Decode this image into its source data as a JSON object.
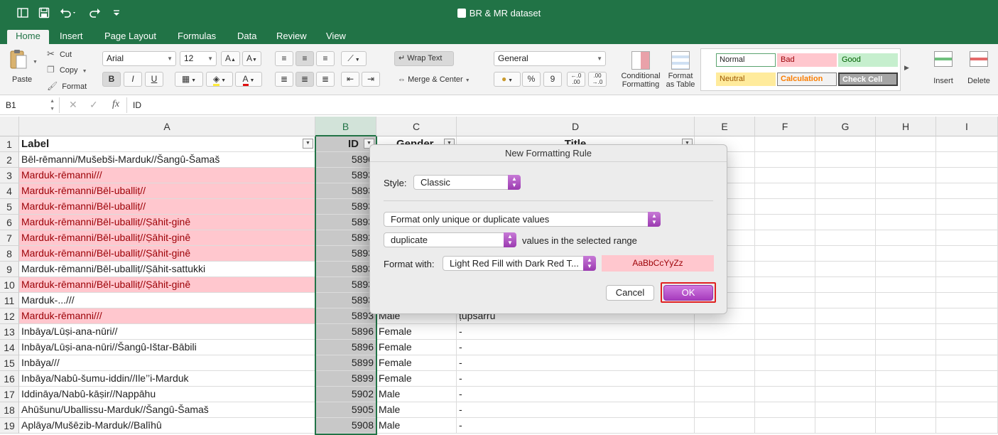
{
  "window": {
    "title": "BR & MR dataset"
  },
  "quick_access": {
    "sidebar_icon": "sidebar-icon",
    "save_icon": "save-icon",
    "undo_icon": "undo-icon",
    "redo_icon": "redo-icon",
    "customize_icon": "customize-icon"
  },
  "tabs": [
    "Home",
    "Insert",
    "Page Layout",
    "Formulas",
    "Data",
    "Review",
    "View"
  ],
  "ribbon": {
    "paste_label": "Paste",
    "cut_label": "Cut",
    "copy_label": "Copy",
    "format_label": "Format",
    "font_name": "Arial",
    "font_size": "12",
    "bold": "B",
    "italic": "I",
    "underline": "U",
    "wrap_text": "Wrap Text",
    "merge_center": "Merge & Center",
    "number_format": "General",
    "percent": "%",
    "comma": "9",
    "conditional_formatting": [
      "Conditional",
      "Formatting"
    ],
    "format_as_table": [
      "Format",
      "as Table"
    ],
    "styles": {
      "normal": "Normal",
      "bad": "Bad",
      "good": "Good",
      "neutral": "Neutral",
      "calculation": "Calculation",
      "check_cell": "Check Cell"
    },
    "insert_label": "Insert",
    "delete_label": "Delete"
  },
  "formula_bar": {
    "name_box": "B1",
    "fx": "fx",
    "content": "ID"
  },
  "columns": [
    "A",
    "B",
    "C",
    "D",
    "E",
    "F",
    "G",
    "H",
    "I"
  ],
  "header_row": {
    "label": "Label",
    "id": "ID",
    "gender": "Gender",
    "title": "Title"
  },
  "rows": [
    {
      "n": "2",
      "label": "Bēl-rēmanni/Mušebši-Marduk//Šangû-Šamaš",
      "id": "5890",
      "gender": "",
      "title": "",
      "dup": false
    },
    {
      "n": "3",
      "label": "Marduk-rēmanni///",
      "id": "5893",
      "gender": "",
      "title": "",
      "dup": true
    },
    {
      "n": "4",
      "label": "Marduk-rēmanni/Bēl-uballiṭ//",
      "id": "5893",
      "gender": "",
      "title": "",
      "dup": true
    },
    {
      "n": "5",
      "label": "Marduk-rēmanni/Bēl-uballiṭ//",
      "id": "5893",
      "gender": "",
      "title": "",
      "dup": true
    },
    {
      "n": "6",
      "label": "Marduk-rēmanni/Bēl-uballiṭ//Ṣāhit-ginê",
      "id": "5893",
      "gender": "",
      "title": "",
      "dup": true
    },
    {
      "n": "7",
      "label": "Marduk-rēmanni/Bēl-uballiṭ//Ṣāhit-ginê",
      "id": "5893",
      "gender": "",
      "title": "",
      "dup": true
    },
    {
      "n": "8",
      "label": "Marduk-rēmanni/Bēl-uballiṭ//Ṣāhit-ginê",
      "id": "5893",
      "gender": "",
      "title": "",
      "dup": true
    },
    {
      "n": "9",
      "label": "Marduk-rēmanni/Bēl-uballiṭ//Ṣāhit-sattukki",
      "id": "5893",
      "gender": "",
      "title": "",
      "dup": false
    },
    {
      "n": "10",
      "label": "Marduk-rēmanni/Bēl-uballiṭ//Ṣāhit-ginê",
      "id": "5893",
      "gender": "",
      "title": "",
      "dup": true
    },
    {
      "n": "11",
      "label": "Marduk-...///",
      "id": "5893",
      "gender": "",
      "title": "",
      "dup": false
    },
    {
      "n": "12",
      "label": "Marduk-rēmanni///",
      "id": "5893",
      "gender": "Male",
      "title": "ṭupsarru",
      "dup": true
    },
    {
      "n": "13",
      "label": "Inbāya/Lūṣi-ana-nūri//",
      "id": "5896",
      "gender": "Female",
      "title": "-",
      "dup": false
    },
    {
      "n": "14",
      "label": "Inbāya/Lūṣi-ana-nūri//Šangû-Ištar-Bābili",
      "id": "5896",
      "gender": "Female",
      "title": "-",
      "dup": false
    },
    {
      "n": "15",
      "label": "Inbāya///",
      "id": "5899",
      "gender": "Female",
      "title": "-",
      "dup": false
    },
    {
      "n": "16",
      "label": "Inbāya/Nabû-šumu-iddin//Ile’’i-Marduk",
      "id": "5899",
      "gender": "Female",
      "title": "-",
      "dup": false
    },
    {
      "n": "17",
      "label": "Iddināya/Nabû-kāṣir//Nappāhu",
      "id": "5902",
      "gender": "Male",
      "title": "-",
      "dup": false
    },
    {
      "n": "18",
      "label": "Ahūšunu/Uballissu-Marduk//Šangû-Šamaš",
      "id": "5905",
      "gender": "Male",
      "title": "-",
      "dup": false
    },
    {
      "n": "19",
      "label": "Aplāya/Mušēzib-Marduk//Balīhû",
      "id": "5908",
      "gender": "Male",
      "title": "-",
      "dup": false
    }
  ],
  "dialog": {
    "title": "New Formatting Rule",
    "style_label": "Style:",
    "style_value": "Classic",
    "rule_type": "Format only unique or duplicate values",
    "dup_value": "duplicate",
    "range_text": "values in the selected range",
    "format_with_label": "Format with:",
    "format_with_value": "Light Red Fill with Dark Red T...",
    "preview": "AaBbCcYyZz",
    "cancel": "Cancel",
    "ok": "OK",
    "colors": {
      "accent": "#b347c6",
      "preview_fill": "#ffc7ce",
      "preview_text": "#9c0006"
    }
  }
}
